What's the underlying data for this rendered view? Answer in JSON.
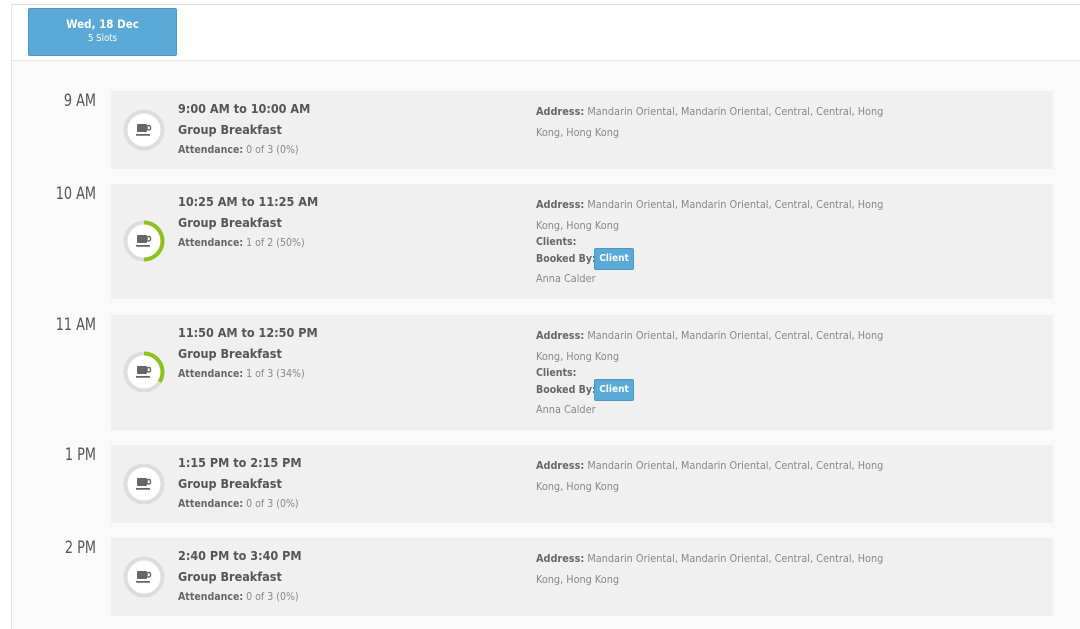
{
  "date_tab": {
    "date": "Wed, 18 Dec",
    "slots": "5 Slots"
  },
  "accent": "#5aa9d6",
  "progress_color": "#8cc21b",
  "slots": [
    {
      "hour": "9 AM",
      "time": "9:00 AM to 10:00 AM",
      "title": "Group Breakfast",
      "attendance_label": "Attendance:",
      "attendance_value": "0 of 3 (0%)",
      "attendance_fraction": 0,
      "address_label": "Address:",
      "address": "Mandarin Oriental, Mandarin Oriental, Central, Central, Hong Kong, Hong Kong",
      "icon": "coffee-cup-icon"
    },
    {
      "hour": "10 AM",
      "time": "10:25 AM to 11:25 AM",
      "title": "Group Breakfast",
      "attendance_label": "Attendance:",
      "attendance_value": "1 of 2 (50%)",
      "attendance_fraction": 0.5,
      "address_label": "Address:",
      "address": "Mandarin Oriental, Mandarin Oriental, Central, Central, Hong Kong, Hong Kong",
      "clients_label": "Clients:",
      "booked_by_label": "Booked By:",
      "badge": "Client",
      "client_name": "Anna Calder",
      "icon": "coffee-cup-icon"
    },
    {
      "hour": "11 AM",
      "time": "11:50 AM to 12:50 PM",
      "title": "Group Breakfast",
      "attendance_label": "Attendance:",
      "attendance_value": "1 of 3 (34%)",
      "attendance_fraction": 0.34,
      "address_label": "Address:",
      "address": "Mandarin Oriental, Mandarin Oriental, Central, Central, Hong Kong, Hong Kong",
      "clients_label": "Clients:",
      "booked_by_label": "Booked By:",
      "badge": "Client",
      "client_name": "Anna Calder",
      "icon": "coffee-cup-icon"
    },
    {
      "hour": "1 PM",
      "time": "1:15 PM to 2:15 PM",
      "title": "Group Breakfast",
      "attendance_label": "Attendance:",
      "attendance_value": "0 of 3 (0%)",
      "attendance_fraction": 0,
      "address_label": "Address:",
      "address": "Mandarin Oriental, Mandarin Oriental, Central, Central, Hong Kong, Hong Kong",
      "icon": "coffee-cup-icon"
    },
    {
      "hour": "2 PM",
      "time": "2:40 PM to 3:40 PM",
      "title": "Group Breakfast",
      "attendance_label": "Attendance:",
      "attendance_value": "0 of 3 (0%)",
      "attendance_fraction": 0,
      "address_label": "Address:",
      "address": "Mandarin Oriental, Mandarin Oriental, Central, Central, Hong Kong, Hong Kong",
      "icon": "coffee-cup-icon"
    }
  ]
}
